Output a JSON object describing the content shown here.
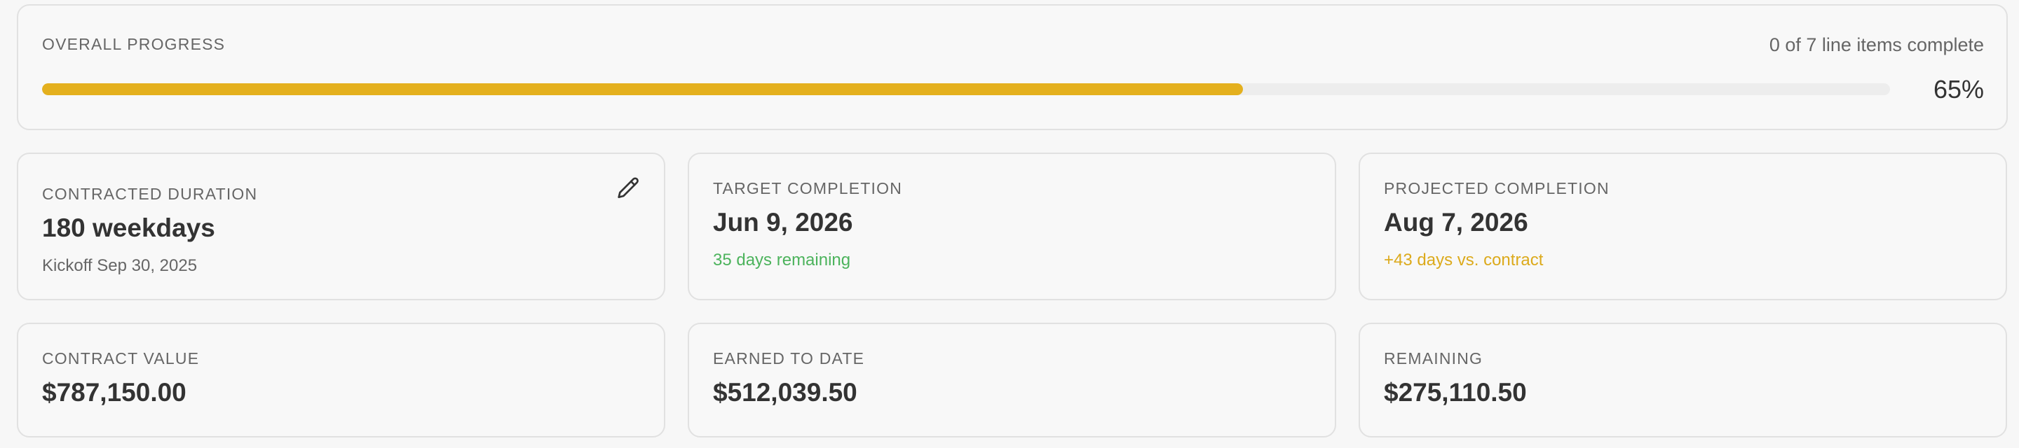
{
  "overall_progress": {
    "label": "OVERALL PROGRESS",
    "items_complete_text": "0 of 7 line items complete",
    "percent_text": "65%",
    "percent_value": 65,
    "bar_color": "#e4b01e",
    "track_color": "#ededed"
  },
  "contracted_duration": {
    "label": "CONTRACTED DURATION",
    "value": "180 weekdays",
    "sub": "Kickoff Sep 30, 2025",
    "edit_icon": "pencil-icon"
  },
  "target_completion": {
    "label": "TARGET COMPLETION",
    "value": "Jun 9, 2026",
    "sub": "35 days remaining",
    "sub_color": "#4cb35c"
  },
  "projected_completion": {
    "label": "PROJECTED COMPLETION",
    "value": "Aug 7, 2026",
    "sub": "+43 days vs. contract",
    "sub_color": "#dcaa1c"
  },
  "contract_value": {
    "label": "CONTRACT VALUE",
    "value": "$787,150.00"
  },
  "earned_to_date": {
    "label": "EARNED TO DATE",
    "value": "$512,039.50"
  },
  "remaining": {
    "label": "REMAINING",
    "value": "$275,110.50"
  }
}
